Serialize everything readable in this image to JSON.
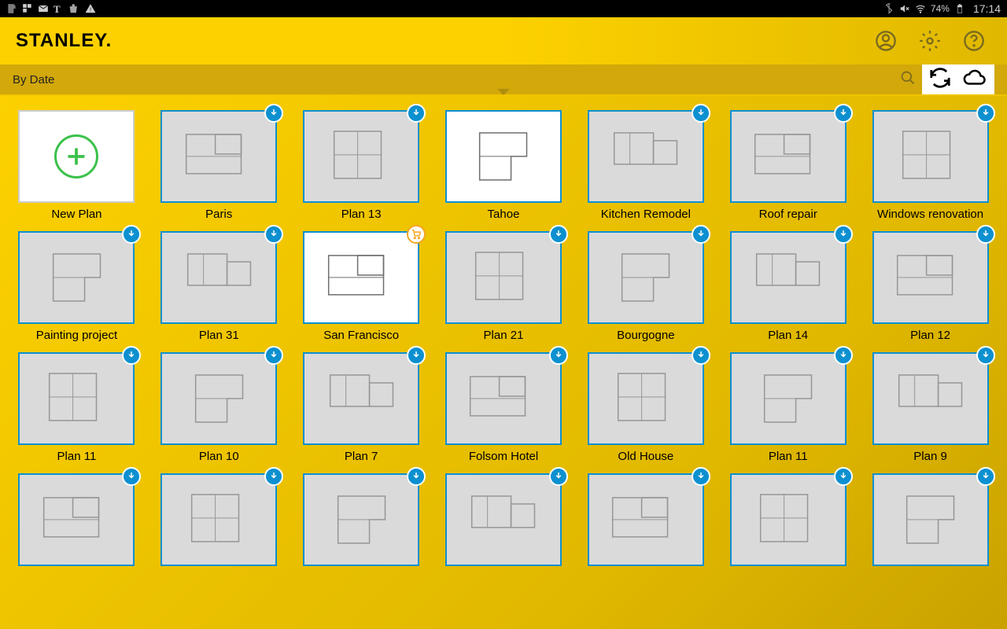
{
  "status": {
    "battery": "74%",
    "time": "17:14"
  },
  "header": {
    "logo": "STANLEY"
  },
  "sort": {
    "label": "By Date"
  },
  "plans": [
    {
      "label": "New Plan",
      "kind": "new"
    },
    {
      "label": "Paris",
      "badge": "download"
    },
    {
      "label": "Plan 13",
      "badge": "download"
    },
    {
      "label": "Tahoe",
      "kind": "white"
    },
    {
      "label": "Kitchen Remodel",
      "badge": "download"
    },
    {
      "label": "Roof repair",
      "badge": "download"
    },
    {
      "label": "Windows renovation",
      "badge": "download"
    },
    {
      "label": "Painting project",
      "badge": "download"
    },
    {
      "label": "Plan 31",
      "badge": "download"
    },
    {
      "label": "San Francisco",
      "kind": "white",
      "badge": "cart"
    },
    {
      "label": "Plan 21",
      "badge": "download"
    },
    {
      "label": "Bourgogne",
      "badge": "download"
    },
    {
      "label": "Plan 14",
      "badge": "download"
    },
    {
      "label": "Plan 12",
      "badge": "download"
    },
    {
      "label": "Plan 11",
      "badge": "download"
    },
    {
      "label": "Plan 10",
      "badge": "download"
    },
    {
      "label": "Plan 7",
      "badge": "download"
    },
    {
      "label": "Folsom Hotel",
      "badge": "download"
    },
    {
      "label": "Old House",
      "badge": "download"
    },
    {
      "label": "Plan 11",
      "badge": "download"
    },
    {
      "label": "Plan 9",
      "badge": "download"
    },
    {
      "label": "",
      "badge": "download"
    },
    {
      "label": "",
      "badge": "download"
    },
    {
      "label": "",
      "badge": "download"
    },
    {
      "label": "",
      "badge": "download"
    },
    {
      "label": "",
      "badge": "download"
    },
    {
      "label": "",
      "badge": "download"
    },
    {
      "label": "",
      "badge": "download"
    }
  ]
}
